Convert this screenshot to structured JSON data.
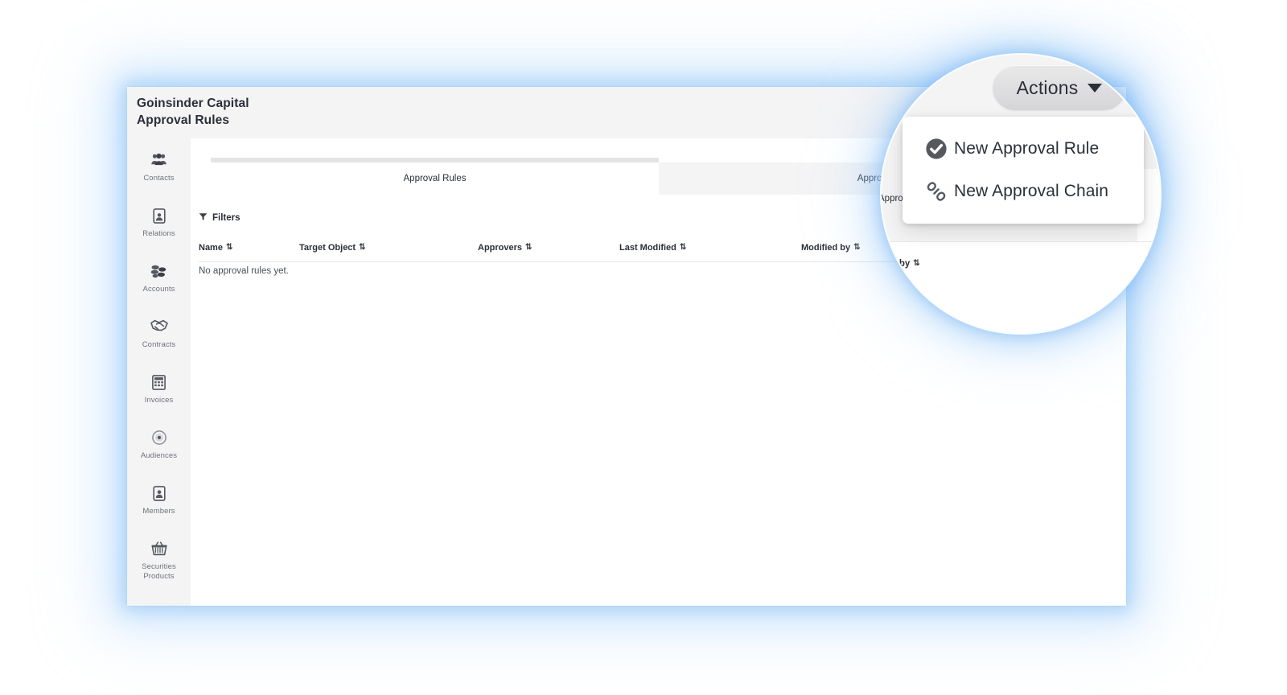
{
  "window": {
    "org_name": "Goinsinder Capital",
    "page_title": "Approval Rules"
  },
  "sidebar": {
    "items": [
      {
        "label": "Contacts",
        "icon": "contacts-icon"
      },
      {
        "label": "Relations",
        "icon": "relations-icon"
      },
      {
        "label": "Accounts",
        "icon": "accounts-icon"
      },
      {
        "label": "Contracts",
        "icon": "contracts-icon"
      },
      {
        "label": "Invoices",
        "icon": "invoices-icon"
      },
      {
        "label": "Audiences",
        "icon": "audiences-icon"
      },
      {
        "label": "Members",
        "icon": "members-icon"
      },
      {
        "label": "Securities Products",
        "label_line1": "Securities",
        "label_line2": "Products",
        "icon": "securities-products-icon"
      }
    ]
  },
  "main": {
    "tabs": [
      {
        "label": "Approval Rules",
        "active": true
      },
      {
        "label": "Approval Chains",
        "active": false
      }
    ],
    "filters_label": "Filters",
    "filters_icon": "funnel-icon",
    "table": {
      "columns": [
        "Name",
        "Target Object",
        "Approvers",
        "Last Modified",
        "Modified by"
      ],
      "sort_glyph": "⇅",
      "empty_message": "No approval rules yet.",
      "rows": []
    }
  },
  "magnifier": {
    "actions_button": {
      "label": "Actions",
      "caret_icon": "chevron-down-icon"
    },
    "menu": [
      {
        "label": "New Approval Rule",
        "icon": "check-circle-icon"
      },
      {
        "label": "New Approval Chain",
        "icon": "chain-link-icon"
      }
    ],
    "ghost": {
      "tab_text": "Appro",
      "column_text": "dified by",
      "sort_glyph": "⇅"
    }
  },
  "colors": {
    "glow": "#7db9f5",
    "header_bg": "#f4f4f5",
    "text": "#2b2f38",
    "muted": "#6e737b",
    "icon_dark": "#55585e"
  }
}
